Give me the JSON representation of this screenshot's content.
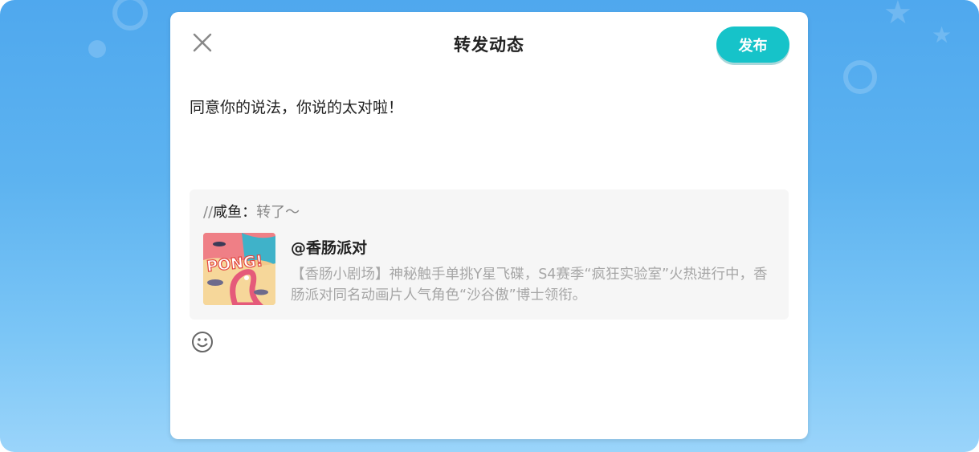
{
  "dialog": {
    "title": "转发动态",
    "publish_label": "发布",
    "comment": "同意你的说法，你说的太对啦！"
  },
  "quote": {
    "slashes": "//",
    "forward_user": "咸鱼：",
    "forward_message": "转了～",
    "post_author": "@香肠派对",
    "post_description": "【香肠小剧场】神秘触手单挑Y星飞碟，S4赛季“疯狂实验室”火热进行中，香肠派对同名动画片人气角色“沙谷傲”博士领衔。",
    "thumbnail_text": "PONG!"
  },
  "icons": {
    "close": "close-icon",
    "emoji": "smiley-icon"
  },
  "colors": {
    "accent": "#16c3c9",
    "background_blue": "#5db3f0",
    "quote_bg": "#f6f6f6",
    "secondary_text": "#a6a6a6"
  }
}
